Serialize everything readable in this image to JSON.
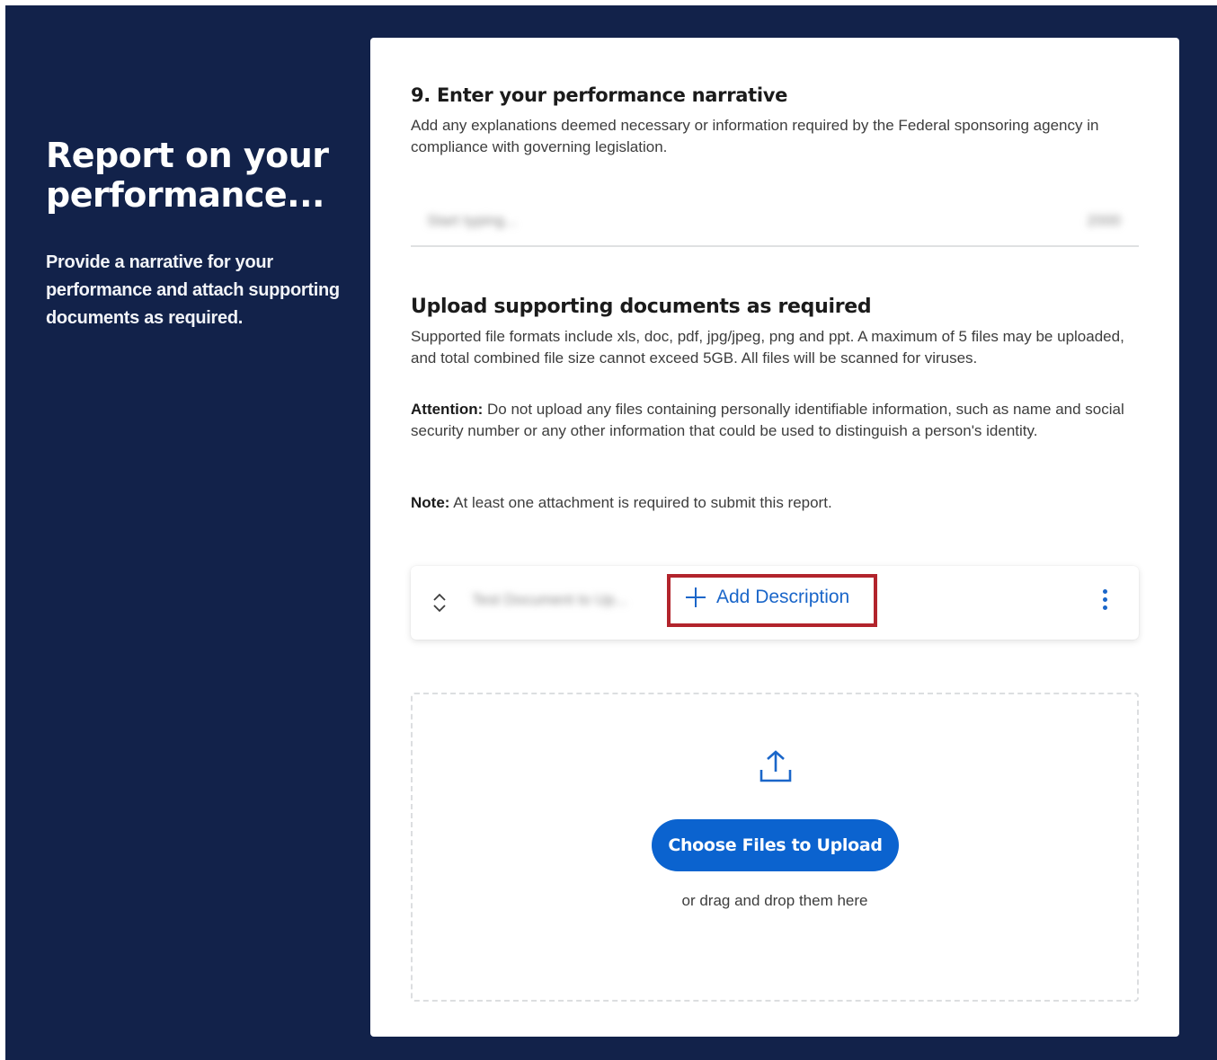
{
  "sidebar": {
    "title": "Report on your performance...",
    "description": "Provide a narrative for your performance and attach supporting documents as required."
  },
  "narrative": {
    "title": "9. Enter your performance narrative",
    "help": "Add any explanations deemed necessary or information required by the Federal sponsoring agency in compliance with governing legislation.",
    "placeholder": "Start typing...",
    "counter": "2000"
  },
  "upload": {
    "title": "Upload supporting documents as required",
    "formats_text": "Supported file formats include xls, doc, pdf, jpg/jpeg, png and ppt. A maximum of 5 files may be uploaded, and total combined file size cannot exceed 5GB. All files will be scanned for viruses.",
    "attention_label": "Attention:",
    "attention_text": " Do not upload any files containing personally identifiable information, such as name and social security number or any other information that could be used to distinguish a person's identity.",
    "note_label": "Note:",
    "note_text": " At least one attachment is required to submit this report.",
    "file": {
      "name": "Test Document to Up...",
      "add_description_label": "Add Description",
      "icons": [
        "reorder-icon",
        "plus-icon",
        "kebab-menu-icon"
      ]
    },
    "dropzone": {
      "icon": "upload-icon",
      "button_label": "Choose Files to Upload",
      "drag_text": "or drag and drop them here"
    }
  },
  "colors": {
    "background": "#12224a",
    "accent": "#0b63cf",
    "link": "#1a66c9",
    "highlight": "#b2242c"
  }
}
